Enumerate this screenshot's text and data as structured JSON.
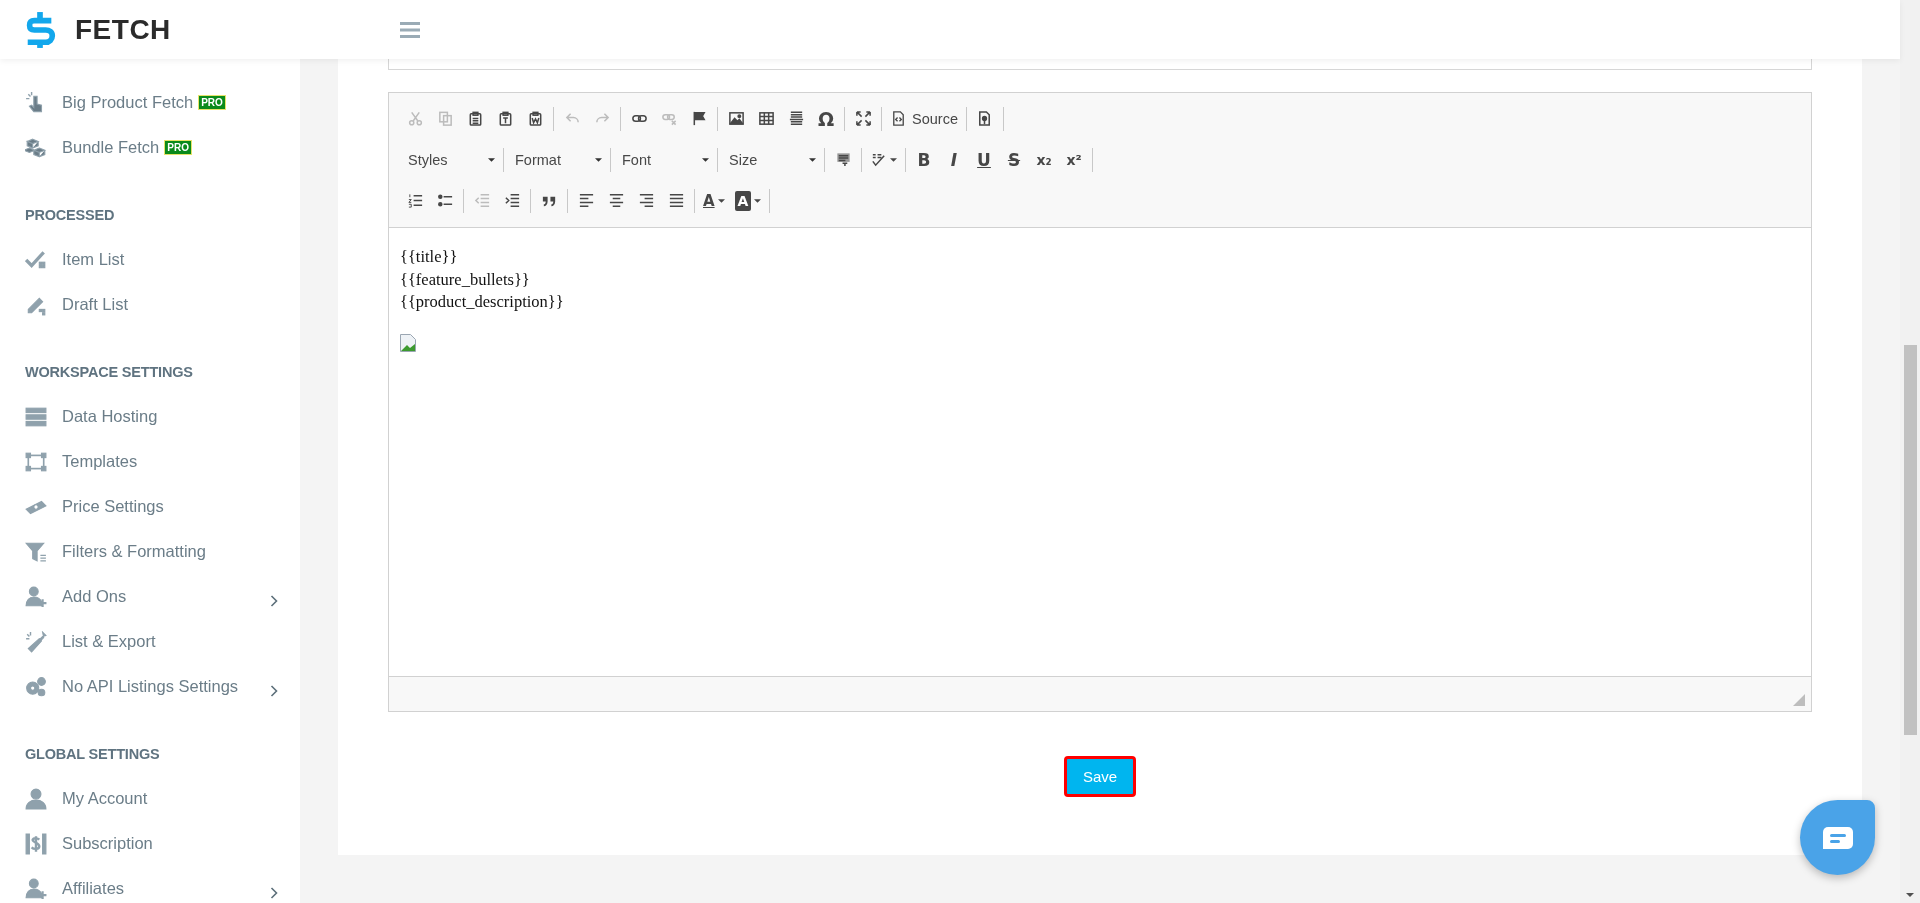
{
  "header": {
    "logo_text": "FETCH"
  },
  "sidebar": {
    "sections": [
      {
        "items": [
          {
            "label": "Big Product Fetch",
            "badge": "PRO",
            "expandable": false
          },
          {
            "label": "Bundle Fetch",
            "badge": "PRO",
            "expandable": false
          }
        ]
      },
      {
        "heading": "PROCESSED",
        "items": [
          {
            "label": "Item List",
            "expandable": false
          },
          {
            "label": "Draft List",
            "expandable": false
          }
        ]
      },
      {
        "heading": "WORKSPACE SETTINGS",
        "items": [
          {
            "label": "Data Hosting",
            "expandable": false
          },
          {
            "label": "Templates",
            "expandable": false
          },
          {
            "label": "Price Settings",
            "expandable": false
          },
          {
            "label": "Filters & Formatting",
            "expandable": false
          },
          {
            "label": "Add Ons",
            "expandable": true
          },
          {
            "label": "List & Export",
            "expandable": false
          },
          {
            "label": "No API Listings Settings",
            "expandable": true
          }
        ]
      },
      {
        "heading": "GLOBAL SETTINGS",
        "items": [
          {
            "label": "My Account",
            "expandable": false
          },
          {
            "label": "Subscription",
            "expandable": false
          },
          {
            "label": "Affiliates",
            "expandable": true
          }
        ]
      }
    ]
  },
  "editor": {
    "toolbar": [
      [
        [
          {
            "kind": "icon",
            "disabled": true
          },
          {
            "kind": "icon",
            "disabled": true
          },
          {
            "kind": "icon",
            "disabled": false
          },
          {
            "kind": "icon",
            "disabled": false
          },
          {
            "kind": "icon",
            "disabled": false
          }
        ],
        [
          {
            "kind": "icon",
            "disabled": true
          },
          {
            "kind": "icon",
            "disabled": true
          }
        ],
        [
          {
            "kind": "icon",
            "disabled": false
          },
          {
            "kind": "icon",
            "disabled": true
          },
          {
            "kind": "icon",
            "disabled": false
          }
        ],
        [
          {
            "kind": "icon",
            "disabled": false
          },
          {
            "kind": "icon",
            "disabled": false
          },
          {
            "kind": "icon",
            "disabled": false
          },
          {
            "kind": "glyph",
            "glyph": "Ω",
            "disabled": false
          }
        ],
        [
          {
            "kind": "icon",
            "disabled": false
          }
        ],
        [
          {
            "kind": "labeled",
            "label": "Source",
            "disabled": false
          }
        ],
        [
          {
            "kind": "icon",
            "disabled": false
          }
        ]
      ],
      [
        [
          {
            "kind": "combo",
            "label": "Styles"
          }
        ],
        [
          {
            "kind": "combo",
            "label": "Format"
          }
        ],
        [
          {
            "kind": "combo",
            "label": "Font"
          }
        ],
        [
          {
            "kind": "combo",
            "label": "Size"
          }
        ],
        [
          {
            "kind": "icon",
            "disabled": false
          }
        ],
        [
          {
            "kind": "icon",
            "disabled": false,
            "caret": true
          }
        ],
        [
          {
            "kind": "glyph",
            "glyph": "B",
            "disabled": false
          },
          {
            "kind": "glyph",
            "glyph": "I",
            "disabled": false
          },
          {
            "kind": "glyph",
            "glyph": "U",
            "disabled": false
          },
          {
            "kind": "glyph",
            "glyph": "S",
            "disabled": false
          },
          {
            "kind": "glyph",
            "glyph": "x₂",
            "disabled": false
          },
          {
            "kind": "glyph",
            "glyph": "x²",
            "disabled": false
          }
        ]
      ],
      [
        [
          {
            "kind": "icon",
            "disabled": false
          },
          {
            "kind": "icon",
            "disabled": false
          }
        ],
        [
          {
            "kind": "icon",
            "disabled": true
          },
          {
            "kind": "icon",
            "disabled": false
          }
        ],
        [
          {
            "kind": "icon",
            "disabled": false
          }
        ],
        [
          {
            "kind": "icon",
            "disabled": false
          },
          {
            "kind": "icon",
            "disabled": false
          },
          {
            "kind": "icon",
            "disabled": false
          },
          {
            "kind": "icon",
            "disabled": false
          }
        ],
        [
          {
            "kind": "glyph",
            "glyph": "A",
            "disabled": false,
            "caret": true
          },
          {
            "kind": "glyph-box",
            "glyph": "A",
            "disabled": false,
            "caret": true
          }
        ]
      ]
    ],
    "lines": [
      "{{title}}",
      "{{feature_bullets}}",
      "{{product_description}}"
    ],
    "broken_image": true
  },
  "save_button": {
    "label": "Save"
  }
}
